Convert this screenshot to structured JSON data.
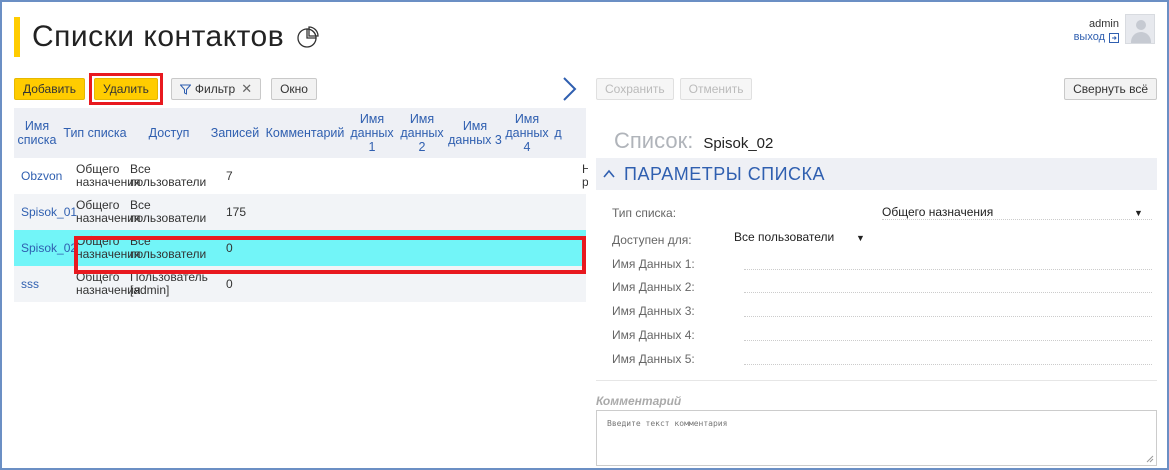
{
  "header": {
    "title": "Списки контактов",
    "user": "admin",
    "logout": "выход"
  },
  "left_toolbar": {
    "add": "Добавить",
    "delete": "Удалить",
    "filter": "Фильтр",
    "window": "Окно"
  },
  "table": {
    "columns": [
      "Имя списка",
      "Тип списка",
      "Доступ",
      "Записей",
      "Комментарий",
      "Имя данных 1",
      "Имя данных 2",
      "Имя данных 3",
      "Имя данных 4",
      "д"
    ],
    "rows": [
      {
        "name": "Obzvon",
        "type1": "Общего",
        "type2": "назначения",
        "access1": "Все",
        "access2": "пользователи",
        "count": "7",
        "overflow1": "Н",
        "overflow2": "р"
      },
      {
        "name": "Spisok_01",
        "type1": "Общего",
        "type2": "назначения",
        "access1": "Все",
        "access2": "пользователи",
        "count": "175",
        "overflow1": "",
        "overflow2": ""
      },
      {
        "name": "Spisok_02",
        "type1": "Общего",
        "type2": "назначения",
        "access1": "Все",
        "access2": "пользователи",
        "count": "0",
        "overflow1": "",
        "overflow2": ""
      },
      {
        "name": "sss",
        "type1": "Общего",
        "type2": "назначения",
        "access1": "Пользователь",
        "access2": "[admin]",
        "count": "0",
        "overflow1": "",
        "overflow2": ""
      }
    ]
  },
  "right_panel": {
    "save": "Сохранить",
    "cancel": "Отменить",
    "collapse_all": "Свернуть всё",
    "list_label": "Список:",
    "list_value": "Spisok_02",
    "section_title": "ПАРАМЕТРЫ СПИСКА",
    "fields": {
      "list_type_label": "Тип списка:",
      "list_type_value": "Общего назначения",
      "available_label": "Доступен для:",
      "available_value": "Все пользователи",
      "data1": "Имя Данных 1:",
      "data2": "Имя Данных 2:",
      "data3": "Имя Данных 3:",
      "data4": "Имя Данных 4:",
      "data5": "Имя Данных 5:"
    },
    "comment_label": "Комментарий",
    "comment_placeholder": "Введите текст комментария"
  },
  "colors": {
    "accent_yellow": "#ffcc00",
    "link_blue": "#2f5fb0",
    "selected_row": "#72f5f8",
    "highlight_red": "#e8191f"
  }
}
